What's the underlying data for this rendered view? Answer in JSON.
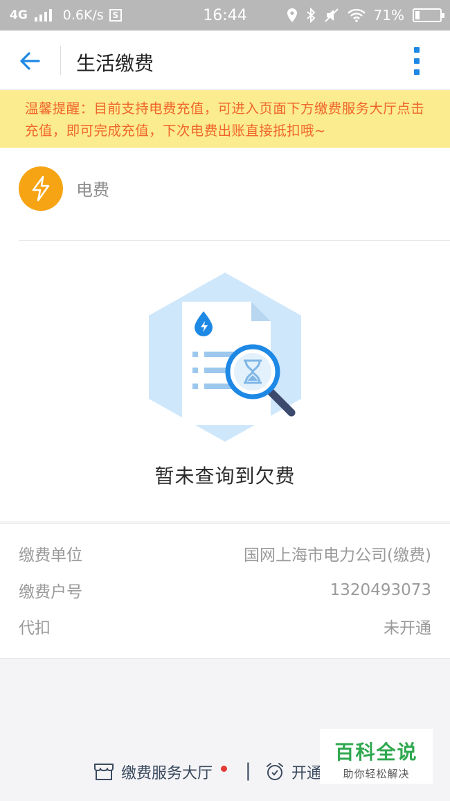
{
  "status_bar": {
    "network": "4G",
    "speed": "0.6K/s",
    "s_badge": "S",
    "time": "16:44",
    "battery_pct": "71%"
  },
  "header": {
    "title": "生活缴费"
  },
  "notice": {
    "text": "温馨提醒：目前支持电费充值，可进入页面下方缴费服务大厅点击充值，即可完成充值，下次电费出账直接抵扣哦~"
  },
  "service": {
    "label": "电费"
  },
  "empty_state": {
    "text": "暂未查询到欠费"
  },
  "info": {
    "rows": [
      {
        "label": "缴费单位",
        "value": "国网上海市电力公司(缴费)"
      },
      {
        "label": "缴费户号",
        "value": "1320493073"
      },
      {
        "label": "代扣",
        "value": "未开通"
      }
    ]
  },
  "bottom": {
    "hall_label": "缴费服务大厅",
    "separator": "|",
    "open_label": "开通"
  },
  "watermark": {
    "title": "百科全说",
    "subtitle": "助你轻松解决"
  },
  "colors": {
    "accent": "#1e88e5",
    "notice_bg": "#fbec8f",
    "notice_text": "#f0662c",
    "electric": "#f6a414"
  }
}
